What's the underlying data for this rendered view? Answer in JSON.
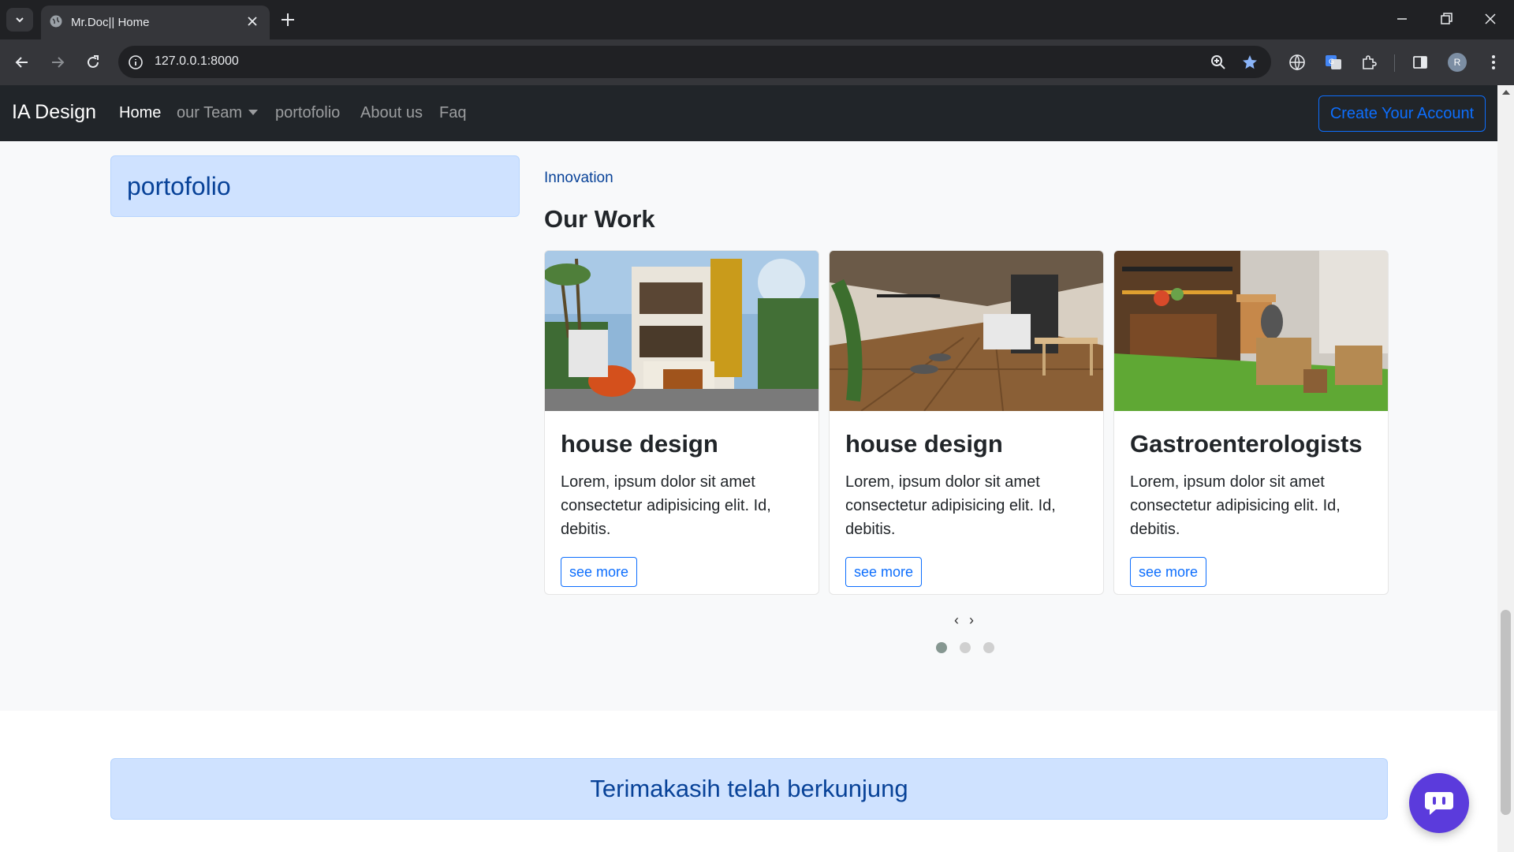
{
  "browser": {
    "tab_title": "Mr.Doc|| Home",
    "url": "127.0.0.1:8000",
    "profile_initial": "R"
  },
  "navbar": {
    "brand": "IA Design",
    "links": {
      "home": "Home",
      "team": "our Team",
      "portfolio": "portofolio",
      "about": "About us",
      "faq": "Faq"
    },
    "cta": "Create Your Account"
  },
  "sidebar": {
    "heading": "portofolio"
  },
  "section": {
    "eyebrow": "Innovation",
    "title": "Our Work"
  },
  "cards": [
    {
      "title": "house design",
      "text": "Lorem, ipsum dolor sit amet consectetur adipisicing elit. Id, debitis.",
      "button": "see more"
    },
    {
      "title": "house design",
      "text": "Lorem, ipsum dolor sit amet consectetur adipisicing elit. Id, debitis.",
      "button": "see more"
    },
    {
      "title": "Gastroenterologists",
      "text": "Lorem, ipsum dolor sit amet consectetur adipisicing elit. Id, debitis.",
      "button": "see more"
    }
  ],
  "carousel": {
    "prev": "‹",
    "next": "›",
    "active_index": 0,
    "count": 3
  },
  "footer": {
    "thanks": "Terimakasih telah berkunjung"
  },
  "colors": {
    "primary": "#0d6efd",
    "alert_bg": "#cfe2ff",
    "alert_text": "#084298",
    "navbar_bg": "#212529",
    "chat_button": "#5b3bdc"
  }
}
